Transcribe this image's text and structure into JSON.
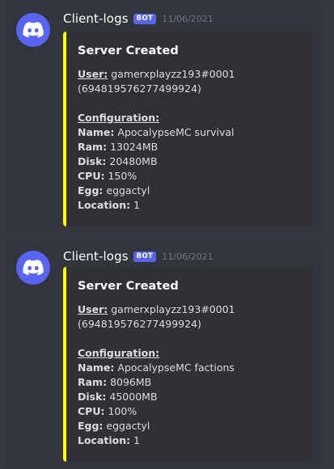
{
  "colors": {
    "background": "#36393f",
    "message_bg": "#32353b",
    "embed_bg": "#2f3136",
    "embed_accent": "#ffff00",
    "blurple": "#5865f2",
    "timestamp": "#72767d"
  },
  "messages": [
    {
      "avatar_icon": "discord-logo-icon",
      "username": "Client-logs",
      "badge": "BOT",
      "timestamp": "11/06/2021",
      "embed": {
        "title": "Server Created",
        "user_label": "User:",
        "user_value": "gamerxplayzz193#0001",
        "user_id": "(694819576277499924)",
        "config_label": "Configuration:",
        "fields": [
          {
            "label": "Name:",
            "value": "ApocalypseMC survival"
          },
          {
            "label": "Ram:",
            "value": "13024MB"
          },
          {
            "label": "Disk:",
            "value": "20480MB"
          },
          {
            "label": "CPU:",
            "value": "150%"
          },
          {
            "label": "Egg:",
            "value": "eggactyl"
          },
          {
            "label": "Location:",
            "value": "1"
          }
        ]
      }
    },
    {
      "avatar_icon": "discord-logo-icon",
      "username": "Client-logs",
      "badge": "BOT",
      "timestamp": "11/06/2021",
      "embed": {
        "title": "Server Created",
        "user_label": "User:",
        "user_value": "gamerxplayzz193#0001",
        "user_id": "(694819576277499924)",
        "config_label": "Configuration:",
        "fields": [
          {
            "label": "Name:",
            "value": "ApocalypseMC factions"
          },
          {
            "label": "Ram:",
            "value": "8096MB"
          },
          {
            "label": "Disk:",
            "value": "45000MB"
          },
          {
            "label": "CPU:",
            "value": "100%"
          },
          {
            "label": "Egg:",
            "value": "eggactyl"
          },
          {
            "label": "Location:",
            "value": "1"
          }
        ]
      }
    }
  ]
}
